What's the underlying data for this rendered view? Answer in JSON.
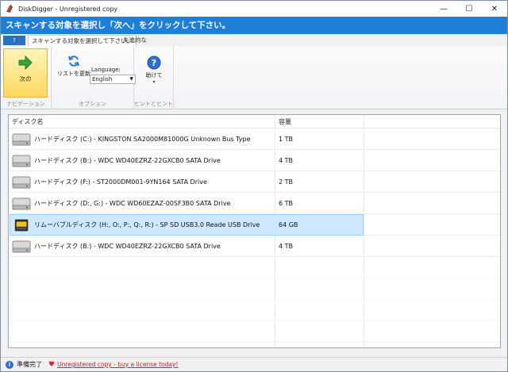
{
  "window": {
    "title": "DiskDigger - Unregistered copy"
  },
  "controls": {
    "minimize": "—",
    "maximize": "☐",
    "close": "✕"
  },
  "banner": {
    "text": "スキャンする対象を選択し「次へ」をクリックして下さい。"
  },
  "ribbon": {
    "file_tab": "?",
    "tabs": [
      "スキャンする対象を選択して下さい。",
      "先進的な"
    ],
    "next_label": "次の",
    "navigation_group": "ナビゲーション",
    "refresh_label": "リストを更新",
    "language_label": "Language:",
    "language_value": "English",
    "options_group": "オプション",
    "help_label": "助けて",
    "help_group": "ヒントとヒント"
  },
  "list": {
    "columns": [
      "ディスク名",
      "容量"
    ],
    "rows": [
      {
        "name": "ハードディスク (C:) - KINGSTON SA2000M81000G Unknown Bus Type",
        "size": "1 TB",
        "icon": "hard-disk-icon"
      },
      {
        "name": "ハードディスク (B:) - WDC WD40EZRZ-22GXCB0 SATA Drive",
        "size": "4 TB",
        "icon": "hard-disk-icon"
      },
      {
        "name": "ハードディスク (F:) - ST2000DM001-9YN164 SATA Drive",
        "size": "2 TB",
        "icon": "hard-disk-icon"
      },
      {
        "name": "ハードディスク (D:, G:) - WDC WD60EZAZ-00SF3B0 SATA Drive",
        "size": "6 TB",
        "icon": "hard-disk-icon"
      },
      {
        "name": "リムーバブルディスク (H:, O:, P:, Q:, R:) - SP SD  USB3.0 Reade USB Drive",
        "size": "64 GB",
        "icon": "removable-disk-icon"
      },
      {
        "name": "ハードディスク (B:) - WDC WD40EZRZ-22GXCB0 SATA Drive",
        "size": "4 TB",
        "icon": "hard-disk-icon"
      }
    ]
  },
  "status": {
    "text": "準備完了",
    "link": "Unregistered copy - buy a license today!"
  },
  "colors": {
    "banner": "#1e7fd8",
    "selected_row": "#cde8ff",
    "link": "#e01b1b"
  }
}
